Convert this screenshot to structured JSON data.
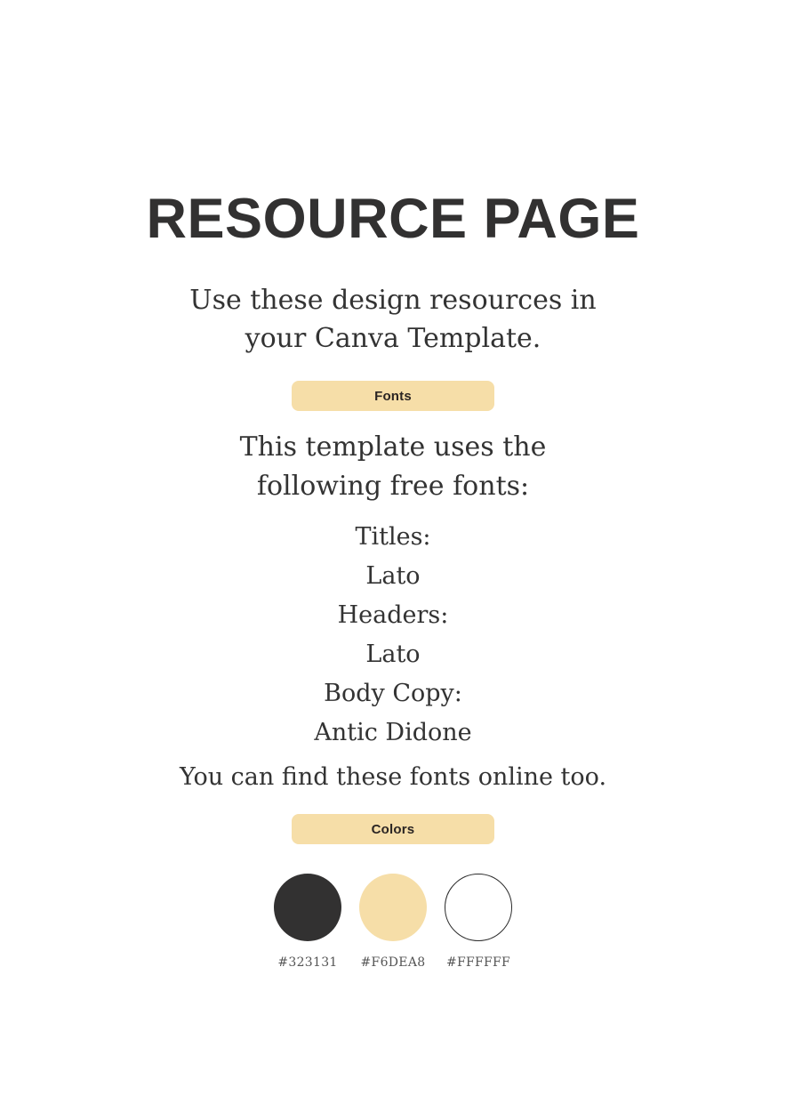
{
  "page": {
    "background_color": "#FFFFFF",
    "title": "RESOURCE PAGE",
    "title_color": "#323131"
  },
  "subtitle": {
    "line1": "Use these design resources in",
    "line2": "your Canva Template."
  },
  "fonts_section": {
    "badge_label": "Fonts",
    "badge_color": "#F6DEA8",
    "intro_line1": "This template uses the",
    "intro_line2": "following free fonts:",
    "entries": [
      {
        "role": "Titles:",
        "name": "Lato"
      },
      {
        "role": "Headers:",
        "name": "Lato"
      },
      {
        "role": "Body Copy:",
        "name": "Antic Didone"
      }
    ],
    "closing_note": "You can find these fonts online too."
  },
  "colors_section": {
    "badge_label": "Colors",
    "badge_color": "#F6DEA8",
    "swatches": [
      {
        "hex": "#323131",
        "label": "#323131",
        "outlined": false
      },
      {
        "hex": "#F6DEA8",
        "label": "#F6DEA8",
        "outlined": false
      },
      {
        "hex": "#FFFFFF",
        "label": "#FFFFFF",
        "outlined": true
      }
    ]
  }
}
